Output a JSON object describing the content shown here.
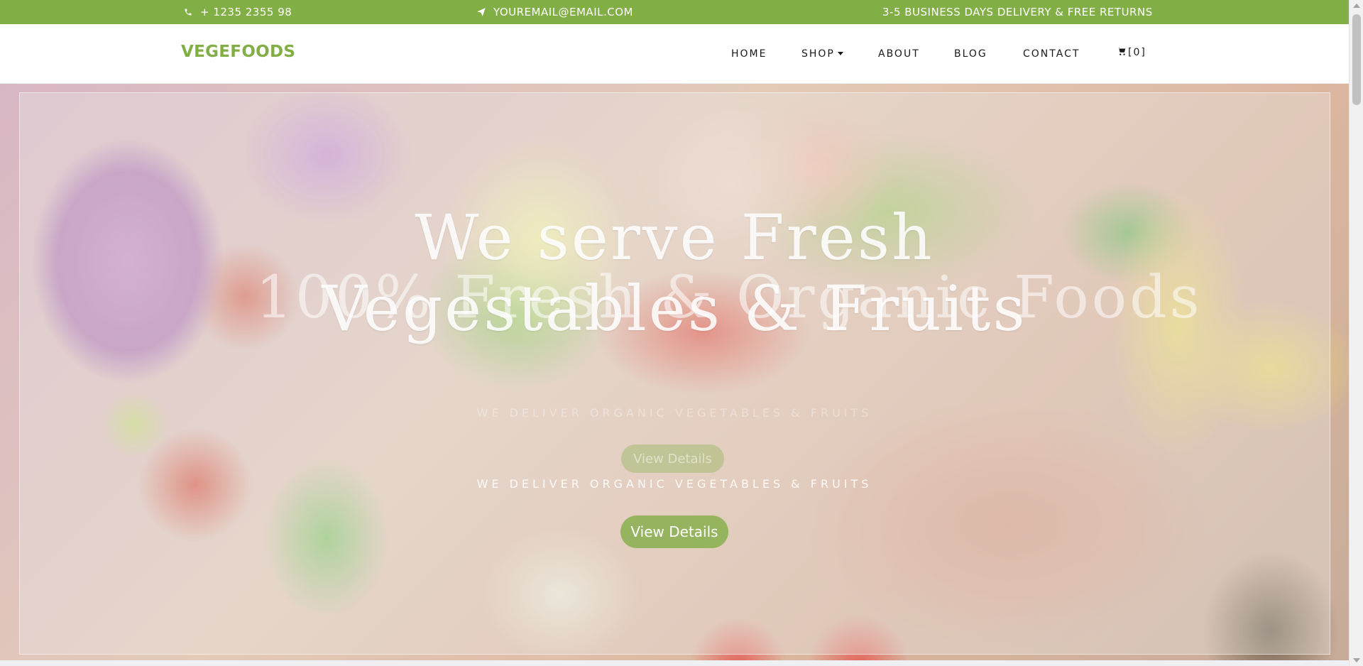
{
  "topbar": {
    "phone": "+ 1235 2355 98",
    "email": "YOUREMAIL@EMAIL.COM",
    "shipping": "3-5 BUSINESS DAYS DELIVERY & FREE RETURNS"
  },
  "brand": {
    "name": "VEGEFOODS",
    "color": "#82ae46"
  },
  "nav": {
    "items": [
      "HOME",
      "SHOP",
      "ABOUT",
      "BLOG",
      "CONTACT"
    ],
    "cart_label": "[0]"
  },
  "hero": {
    "title": "We serve Fresh Vegestables & Fruits",
    "subtitle": "WE DELIVER ORGANIC VEGETABLES & FRUITS",
    "button_label": "View Details",
    "previous_slide_title": "100% Fresh & Organic Foods",
    "previous_slide_subtitle": "WE DELIVER ORGANIC VEGETABLES & FRUITS",
    "previous_slide_button": "View Details"
  },
  "icons": {
    "phone": "phone-icon",
    "email": "paper-plane-icon",
    "cart": "cart-icon"
  },
  "colors": {
    "accent": "#82ae46",
    "nav_text": "#1a1a1a"
  }
}
